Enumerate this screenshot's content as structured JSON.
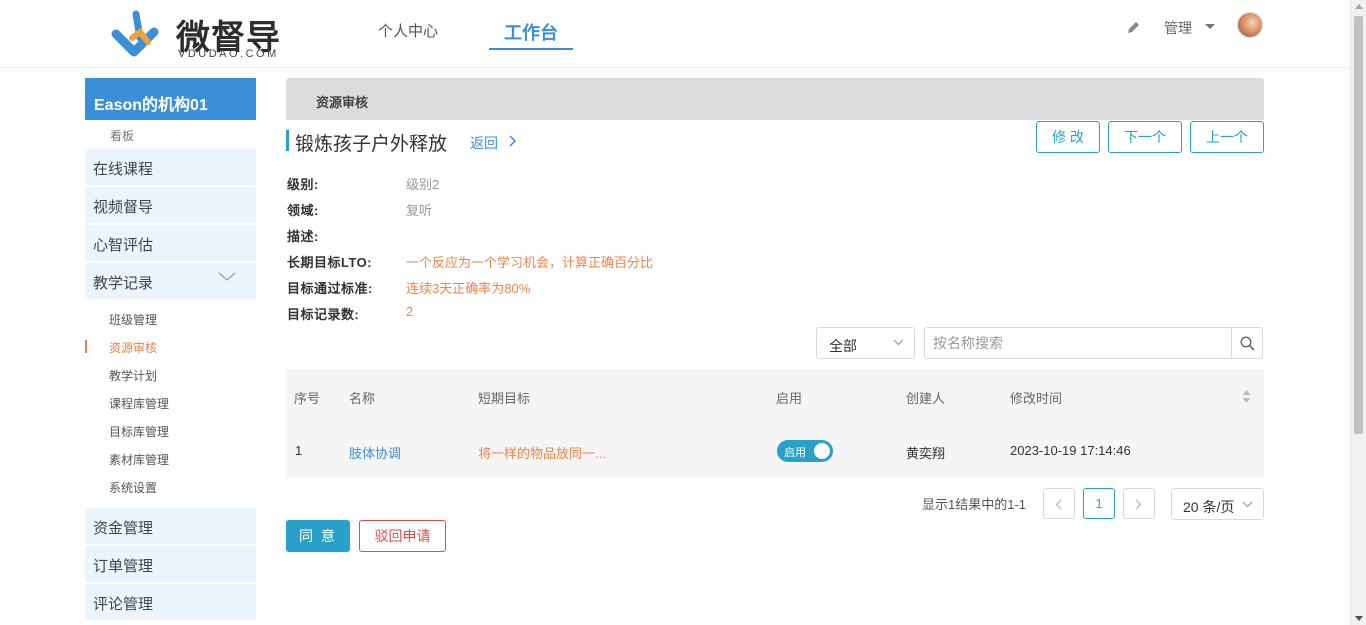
{
  "header": {
    "logo_title": "微督导",
    "logo_sub": "VDUDAO.COM",
    "nav": [
      "个人中心",
      "工作台"
    ],
    "manage_label": "管理"
  },
  "sidebar": {
    "org_name": "Eason的机构01",
    "dashboard": "看板",
    "items": [
      "在线课程",
      "视频督导",
      "心智评估",
      "教学记录"
    ],
    "sub_items": [
      "班级管理",
      "资源审核",
      "教学计划",
      "课程库管理",
      "目标库管理",
      "素材库管理",
      "系统设置"
    ],
    "bottom_items": [
      "资金管理",
      "订单管理",
      "评论管理"
    ]
  },
  "main": {
    "breadcrumb": "资源审核",
    "title": "锻炼孩子户外释放",
    "back_label": "返回",
    "buttons": {
      "edit": "修 改",
      "next": "下一个",
      "prev": "上一个"
    },
    "fields": [
      {
        "label": "级别:",
        "value": "级别2"
      },
      {
        "label": "领域:",
        "value": "复听"
      },
      {
        "label": "描述:",
        "value": ""
      },
      {
        "label": "长期目标LTO:",
        "value": "一个反应为一个学习机会，计算正确百分比"
      },
      {
        "label": "目标通过标准:",
        "value": "连续3天正确率为80%"
      },
      {
        "label": "目标记录数:",
        "value": "2"
      }
    ],
    "filter": {
      "selected": "全部"
    },
    "search": {
      "placeholder": "按名称搜索"
    },
    "table": {
      "columns": [
        "序号",
        "名称",
        "短期目标",
        "启用",
        "创建人",
        "修改时间"
      ],
      "rows": [
        {
          "index": "1",
          "name": "肢体协调",
          "sto": "将一样的物品放同一...",
          "enabled_label": "启用",
          "creator": "黄奕翔",
          "modified": "2023-10-19 17:14:46"
        }
      ]
    },
    "pagination": {
      "info": "显示1结果中的1-1",
      "current": "1",
      "page_size": "20 条/页"
    },
    "actions": {
      "agree": "同 意",
      "reject": "驳回申请"
    }
  },
  "colors": {
    "primary": "#3b8fd8",
    "teal": "#29a0c7",
    "orange": "#f0834a",
    "danger": "#e84a4a"
  }
}
